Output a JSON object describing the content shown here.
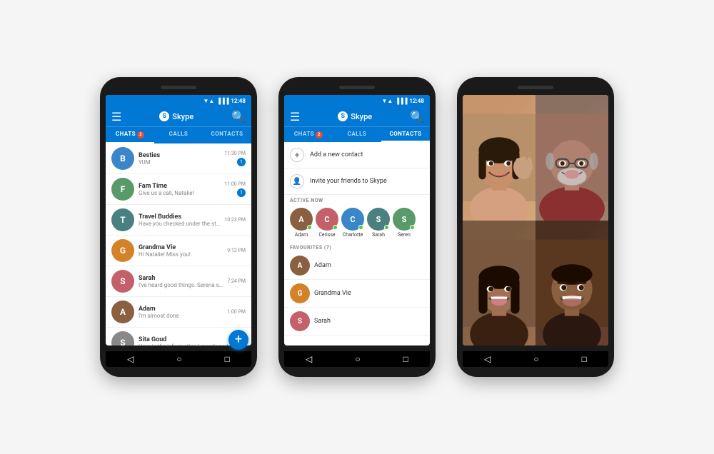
{
  "phones": {
    "phone1": {
      "status_bar": {
        "time": "12:48",
        "icons": "▼▲● ▐▐▐"
      },
      "header": {
        "menu_icon": "☰",
        "logo_s": "S",
        "logo_text": "Skype",
        "search_icon": "🔍"
      },
      "tabs": [
        {
          "label": "CHATS",
          "badge": "2",
          "active": true
        },
        {
          "label": "CALLS",
          "active": false
        },
        {
          "label": "CONTACTS",
          "active": false
        }
      ],
      "chats": [
        {
          "name": "Besties",
          "preview": "YUM",
          "time": "11:30 PM",
          "unread": "1",
          "av_letter": "B",
          "av_class": "av-blue"
        },
        {
          "name": "Fam Time",
          "preview": "Give us a call, Natalie!",
          "time": "11:00 PM",
          "unread": "1",
          "av_letter": "F",
          "av_class": "av-green"
        },
        {
          "name": "Travel Buddies",
          "preview": "Have you checked under the stairs?",
          "time": "10:23 PM",
          "unread": "",
          "av_letter": "T",
          "av_class": "av-teal"
        },
        {
          "name": "Grandma Vie",
          "preview": "Hi Natalie! Miss you!",
          "time": "9:12 PM",
          "unread": "",
          "av_letter": "G",
          "av_class": "av-orange"
        },
        {
          "name": "Sarah",
          "preview": "I've heard good things. Serena said she...",
          "time": "7:24 PM",
          "unread": "",
          "av_letter": "S",
          "av_class": "av-pink"
        },
        {
          "name": "Adam",
          "preview": "I'm almost done",
          "time": "1:00 PM",
          "unread": "",
          "av_letter": "A",
          "av_class": "av-brown"
        },
        {
          "name": "Sita Goud",
          "preview": "Here is the information I mentioned",
          "time": "",
          "unread": "",
          "av_letter": "S",
          "av_class": "av-gray"
        }
      ],
      "fab": "+"
    },
    "phone2": {
      "status_bar": {
        "time": "12:48"
      },
      "header": {
        "menu_icon": "☰",
        "logo_s": "S",
        "logo_text": "Skype",
        "search_icon": "🔍"
      },
      "tabs": [
        {
          "label": "CHATS",
          "badge": "2",
          "active": false
        },
        {
          "label": "CALLS",
          "active": false
        },
        {
          "label": "CONTACTS",
          "active": true
        }
      ],
      "actions": [
        {
          "icon": "+",
          "label": "Add a new contact"
        },
        {
          "icon": "👤",
          "label": "Invite your friends to Skype"
        }
      ],
      "active_section": "ACTIVE NOW",
      "active_contacts": [
        {
          "name": "Adam",
          "av_letter": "A",
          "av_class": "av-brown"
        },
        {
          "name": "Cerisse",
          "av_letter": "C",
          "av_class": "av-pink"
        },
        {
          "name": "Charlotte",
          "av_letter": "C",
          "av_class": "av-blue"
        },
        {
          "name": "Sarah",
          "av_letter": "S",
          "av_class": "av-teal"
        },
        {
          "name": "Seren",
          "av_letter": "S",
          "av_class": "av-green"
        }
      ],
      "favourites_section": "FAVOURITES (7)",
      "favourites": [
        {
          "name": "Adam",
          "av_letter": "A",
          "av_class": "av-brown"
        },
        {
          "name": "Grandma Vie",
          "av_letter": "G",
          "av_class": "av-orange"
        },
        {
          "name": "Sarah",
          "av_letter": "S",
          "av_class": "av-pink"
        }
      ]
    },
    "phone3": {
      "video_call": {
        "participants": [
          {
            "position": "top-left",
            "bg": "#c8a080",
            "emoji": "👩"
          },
          {
            "position": "top-right",
            "bg": "#9a8070",
            "emoji": "👴"
          },
          {
            "position": "bot-left",
            "bg": "#8a6050",
            "emoji": "👩"
          },
          {
            "position": "bot-right",
            "bg": "#6a5040",
            "emoji": "👨"
          }
        ]
      }
    }
  },
  "nav": {
    "back": "◁",
    "home": "○",
    "recent": "□"
  }
}
